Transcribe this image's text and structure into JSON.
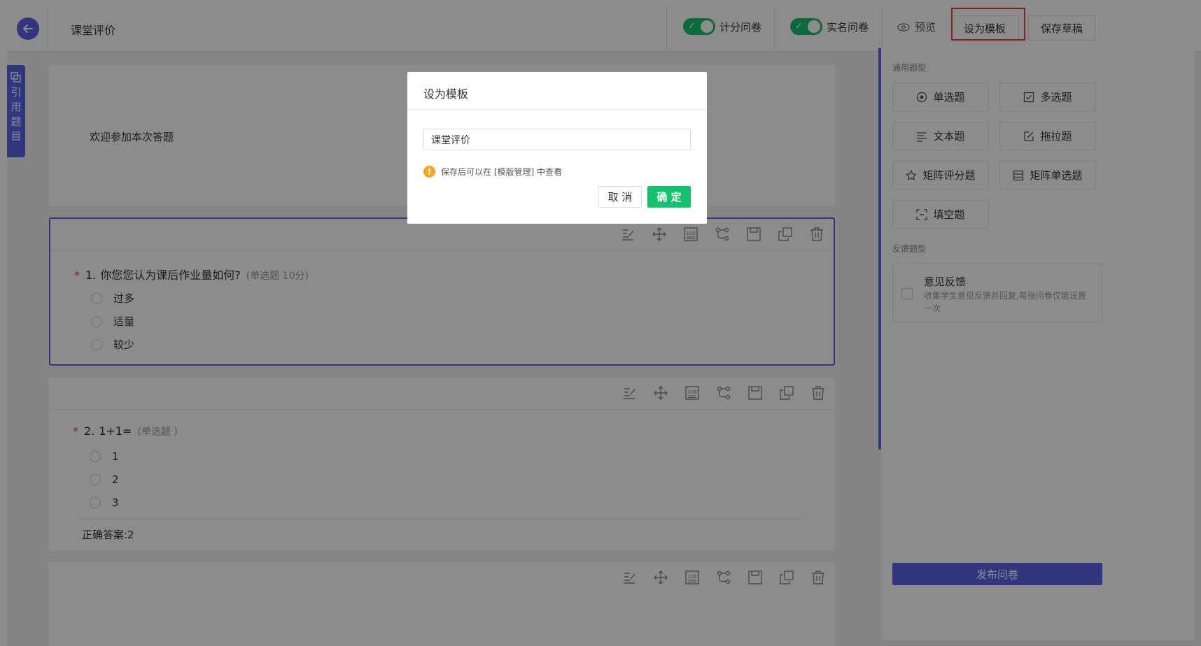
{
  "header": {
    "title": "课堂评价",
    "toggle_scoring_label": "计分问卷",
    "toggle_realname_label": "实名问卷",
    "preview_label": "预览",
    "set_template_label": "设为模板",
    "save_draft_label": "保存草稿"
  },
  "cite_tab": {
    "chars": [
      "引",
      "用",
      "题",
      "目"
    ]
  },
  "intro": {
    "text": "欢迎参加本次答题"
  },
  "questions": [
    {
      "number": "1.",
      "title": "你您您认为课后作业量如何?",
      "meta": "(单选题 10分)",
      "options": [
        "过多",
        "适量",
        "较少"
      ]
    },
    {
      "number": "2.",
      "title": "1+1=",
      "meta": "(单选题 )",
      "options": [
        "1",
        "2",
        "3"
      ],
      "answer": "正确答案:2"
    }
  ],
  "right_panel": {
    "general_title": "通用题型",
    "types": [
      "单选题",
      "多选题",
      "文本题",
      "拖拉题",
      "矩阵评分题",
      "矩阵单选题",
      "填空题"
    ],
    "feedback_title": "反馈题型",
    "feedback_name": "意见反馈",
    "feedback_desc": "收集学生意见反馈并回复,每张问卷仅能设置一次",
    "publish_label": "发布问卷"
  },
  "modal": {
    "title": "设为模板",
    "input_value": "课堂评价",
    "tip": "保存后可以在 [模版管理] 中查看",
    "cancel_label": "取 消",
    "ok_label": "确 定"
  },
  "colors": {
    "primary": "#5b63e6",
    "success": "#13c26b",
    "danger": "#e8403c",
    "warning": "#f5a623"
  }
}
